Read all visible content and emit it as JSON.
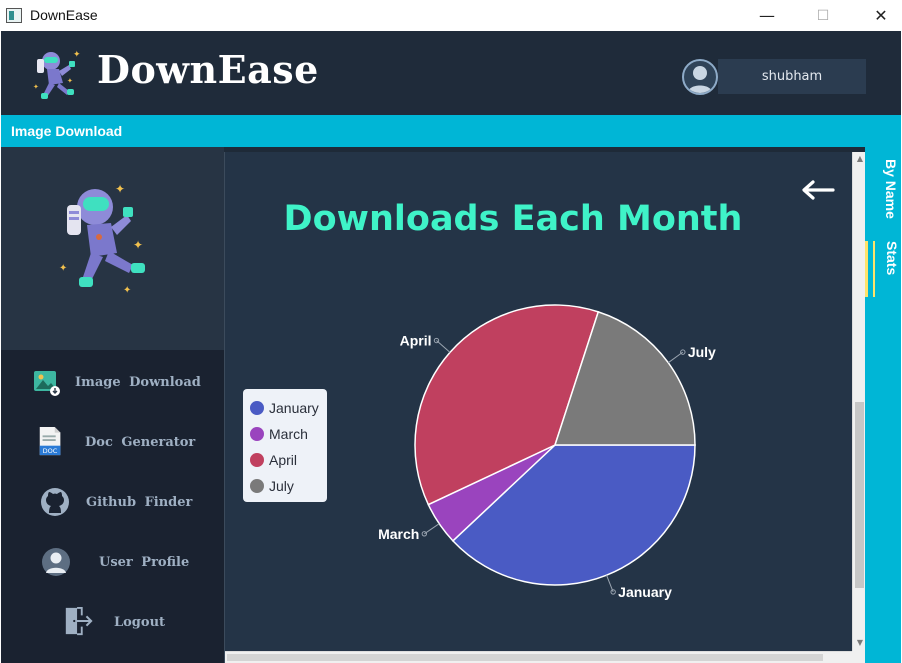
{
  "window": {
    "title": "DownEase",
    "controls": {
      "minimize": "—",
      "maximize": "☐",
      "close": "✕"
    }
  },
  "header": {
    "brand": "DownEase",
    "username": "shubham"
  },
  "section_bar": {
    "label": "Image Download"
  },
  "sidebar": {
    "items": [
      {
        "label": "Image Download",
        "icon": "image-download-icon"
      },
      {
        "label": "Doc Generator",
        "icon": "doc-icon"
      },
      {
        "label": "Github Finder",
        "icon": "github-icon"
      },
      {
        "label": "User Profile",
        "icon": "user-icon"
      },
      {
        "label": "Logout",
        "icon": "logout-icon"
      }
    ]
  },
  "right_tabs": [
    {
      "label": "By Name"
    },
    {
      "label": "Stats"
    }
  ],
  "main": {
    "title": "Downloads Each Month"
  },
  "chart_data": {
    "type": "pie",
    "title": "Downloads Each Month",
    "categories": [
      "January",
      "March",
      "April",
      "July"
    ],
    "values": [
      38,
      5,
      37,
      20
    ],
    "colors": [
      "#4a5bc4",
      "#9a44be",
      "#c0405f",
      "#7a7a7a"
    ],
    "legend": [
      "January",
      "March",
      "April",
      "July"
    ],
    "legend_position": "left"
  },
  "colors": {
    "accent": "#00b6d6",
    "title": "#3ff3c8",
    "header_bg": "#1f2b3a",
    "main_bg": "#243447"
  }
}
